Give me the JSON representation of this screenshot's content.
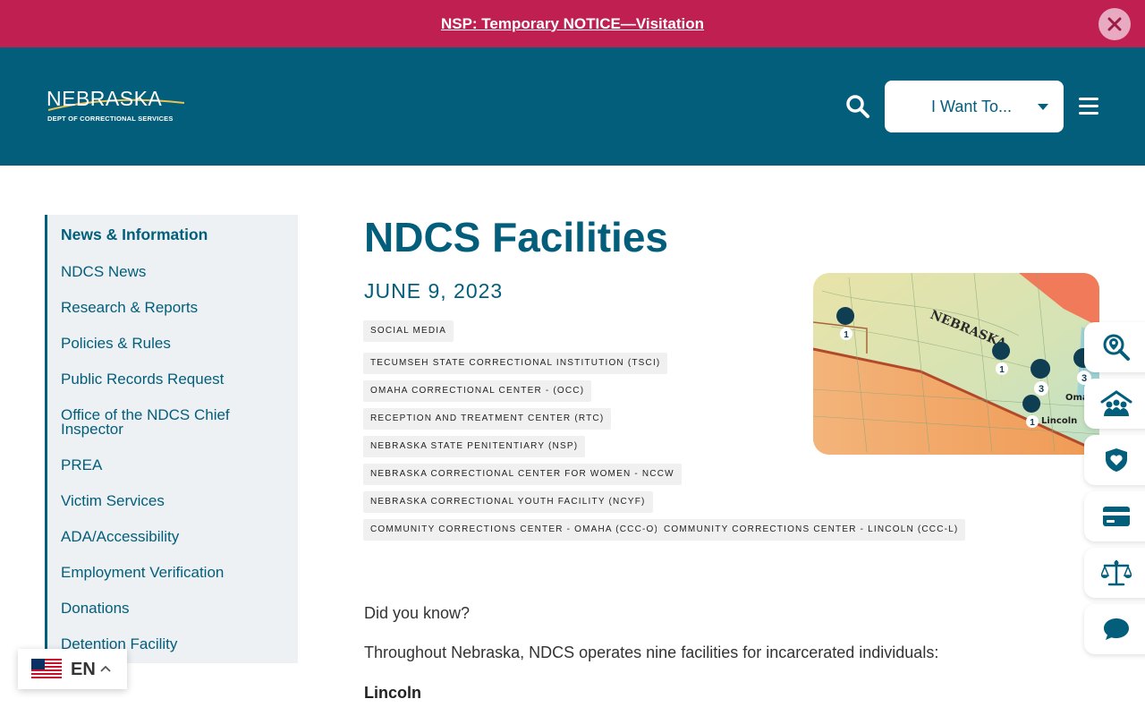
{
  "alert": {
    "text": "NSP: Temporary NOTICE—Visitation"
  },
  "header": {
    "logo_word": "NEBRASKA",
    "logo_sub": "DEPT OF CORRECTIONAL SERVICES",
    "want_label": "I Want To..."
  },
  "sidebar": {
    "title": "News & Information",
    "items": [
      "NDCS News",
      "Research & Reports",
      "Policies & Rules",
      "Public Records Request",
      "Office of the NDCS Chief Inspector",
      "PREA",
      "Victim Services",
      "ADA/Accessibility",
      "Employment Verification",
      "Donations",
      "Detention Facility"
    ]
  },
  "article": {
    "title": "NDCS Facilities",
    "date": "JUNE 9, 2023",
    "tags": [
      "SOCIAL MEDIA",
      "TECUMSEH STATE CORRECTIONAL INSTITUTION (TSCI)",
      "OMAHA CORRECTIONAL CENTER - (OCC)",
      "RECEPTION AND TREATMENT CENTER (RTC)",
      "NEBRASKA STATE PENITENTIARY (NSP)",
      "NEBRASKA CORRECTIONAL CENTER FOR WOMEN - NCCW",
      "NEBRASKA CORRECTIONAL YOUTH FACILITY (NCYF)",
      "COMMUNITY CORRECTIONS CENTER - OMAHA (CCC-O)",
      "COMMUNITY CORRECTIONS CENTER - LINCOLN (CCC-L)"
    ],
    "paragraph1": "Did you know?",
    "paragraph2": "Throughout Nebraska, NDCS operates nine facilities for incarcerated individuals:",
    "subheading": "Lincoln",
    "map": {
      "state_label": "NEBRASKA",
      "cities": [
        "Omaha",
        "Lincoln"
      ],
      "markers": [
        "1",
        "1",
        "3",
        "3",
        "1"
      ]
    }
  },
  "quick_links": [
    "map-pin-search-icon",
    "family-icon",
    "shield-heart-icon",
    "card-icon",
    "scales-icon",
    "chat-icon"
  ],
  "language": {
    "code": "EN"
  },
  "colors": {
    "primary": "#035e7b",
    "alert": "#c01f52",
    "sidebar_bg": "#edf1f4"
  }
}
